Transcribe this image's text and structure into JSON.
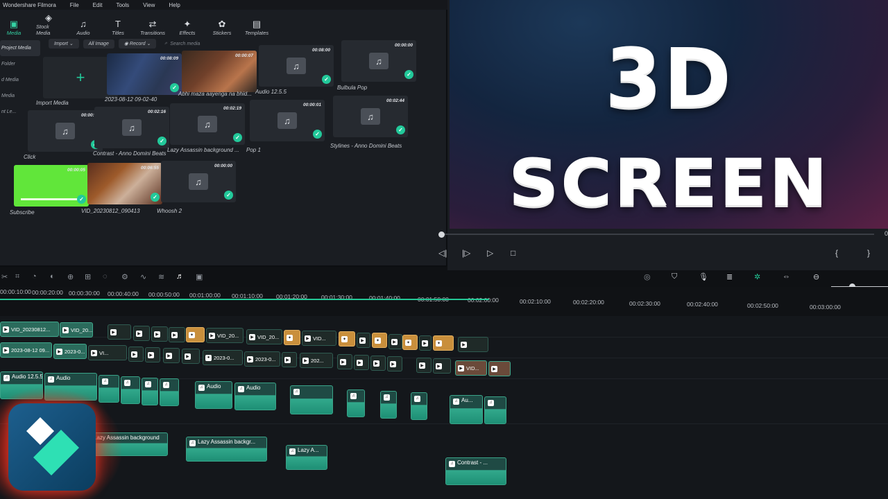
{
  "app": {
    "title": "Wondershare Filmora",
    "menu": [
      "File",
      "Edit",
      "Tools",
      "View",
      "Help"
    ]
  },
  "toolbar": {
    "tabs": [
      {
        "label": "Media",
        "icon": "media-icon",
        "active": true
      },
      {
        "label": "Stock Media",
        "icon": "stock-media-icon"
      },
      {
        "label": "Audio",
        "icon": "audio-icon"
      },
      {
        "label": "Titles",
        "icon": "titles-icon"
      },
      {
        "label": "Transitions",
        "icon": "transitions-icon"
      },
      {
        "label": "Effects",
        "icon": "effects-icon"
      },
      {
        "label": "Stickers",
        "icon": "stickers-icon"
      },
      {
        "label": "Templates",
        "icon": "templates-icon"
      }
    ]
  },
  "sidebar": {
    "items": [
      "Project Media",
      "Folder",
      "d Media",
      "Media",
      "nt Le..."
    ]
  },
  "filters": {
    "import": "Import",
    "all_image": "All Image",
    "record": "Record",
    "search_placeholder": "Search media"
  },
  "media": {
    "import_label": "Import Media",
    "items": [
      {
        "name": "2023-08-12 09-02-40",
        "duration": "00:08:09",
        "kind": "video"
      },
      {
        "name": "Abhi maza aayenga na bhid...",
        "duration": "00:00:07",
        "kind": "video"
      },
      {
        "name": "Audio 12.5.5",
        "duration": "00:08:00",
        "kind": "audio"
      },
      {
        "name": "Bulbula Pop",
        "duration": "00:00:00",
        "kind": "audio"
      },
      {
        "name": "Click",
        "duration": "00:00:01",
        "kind": "audio"
      },
      {
        "name": "Contrast - Anno Domini Beats",
        "duration": "00:02:16",
        "kind": "audio"
      },
      {
        "name": "Lazy Assassin background ...",
        "duration": "00:02:19",
        "kind": "audio"
      },
      {
        "name": "Pop 1",
        "duration": "00:00:01",
        "kind": "audio"
      },
      {
        "name": "Stylines - Anno Domini Beats",
        "duration": "00:02:44",
        "kind": "audio"
      },
      {
        "name": "Subscribe",
        "duration": "00:00:05",
        "kind": "green"
      },
      {
        "name": "VID_20230812_090413",
        "duration": "00:06:55",
        "kind": "video"
      },
      {
        "name": "Whoosh 2",
        "duration": "00:00:00",
        "kind": "audio"
      }
    ]
  },
  "preview": {
    "headline_1": "3D",
    "headline_2": "SCREEN",
    "time_end": "0",
    "progress": 0
  },
  "timeline": {
    "ruler": [
      "00:00:10:00",
      "00:00:20:00",
      "00:00:30:00",
      "00:00:40:00",
      "00:00:50:00",
      "00:01:00:00",
      "00:01:10:00",
      "00:01:20:00",
      "00:01:30:00",
      "00:01:40:00",
      "00:01:50:00",
      "00:02:00:00",
      "00:02:10:00",
      "00:02:20:00",
      "00:02:30:00",
      "00:02:40:00",
      "00:02:50:00",
      "00:03:00:00"
    ],
    "video_clips_1": [
      "VID_20230812...",
      "VID_20...",
      "VID_20...",
      "VID_20...",
      "VID..."
    ],
    "video_clips_2": [
      "2023-08-12 09...",
      "2023-0...",
      "VI...",
      "2023-0...",
      "2023-0...",
      "202..."
    ],
    "audio_clips": [
      "Audio 12.5.5",
      "Audio",
      "Audio",
      "Audio",
      "Au..."
    ],
    "bg_clips": [
      "Lazy Assassin background",
      "Lazy Assassin backgr...",
      "Lazy A...",
      "Contrast - ..."
    ],
    "vid_tail": "VID..."
  },
  "colors": {
    "accent": "#22c99a",
    "panel": "#1a1d22",
    "clip": "#2b6b5c",
    "clip_orange": "#c98f3c"
  }
}
